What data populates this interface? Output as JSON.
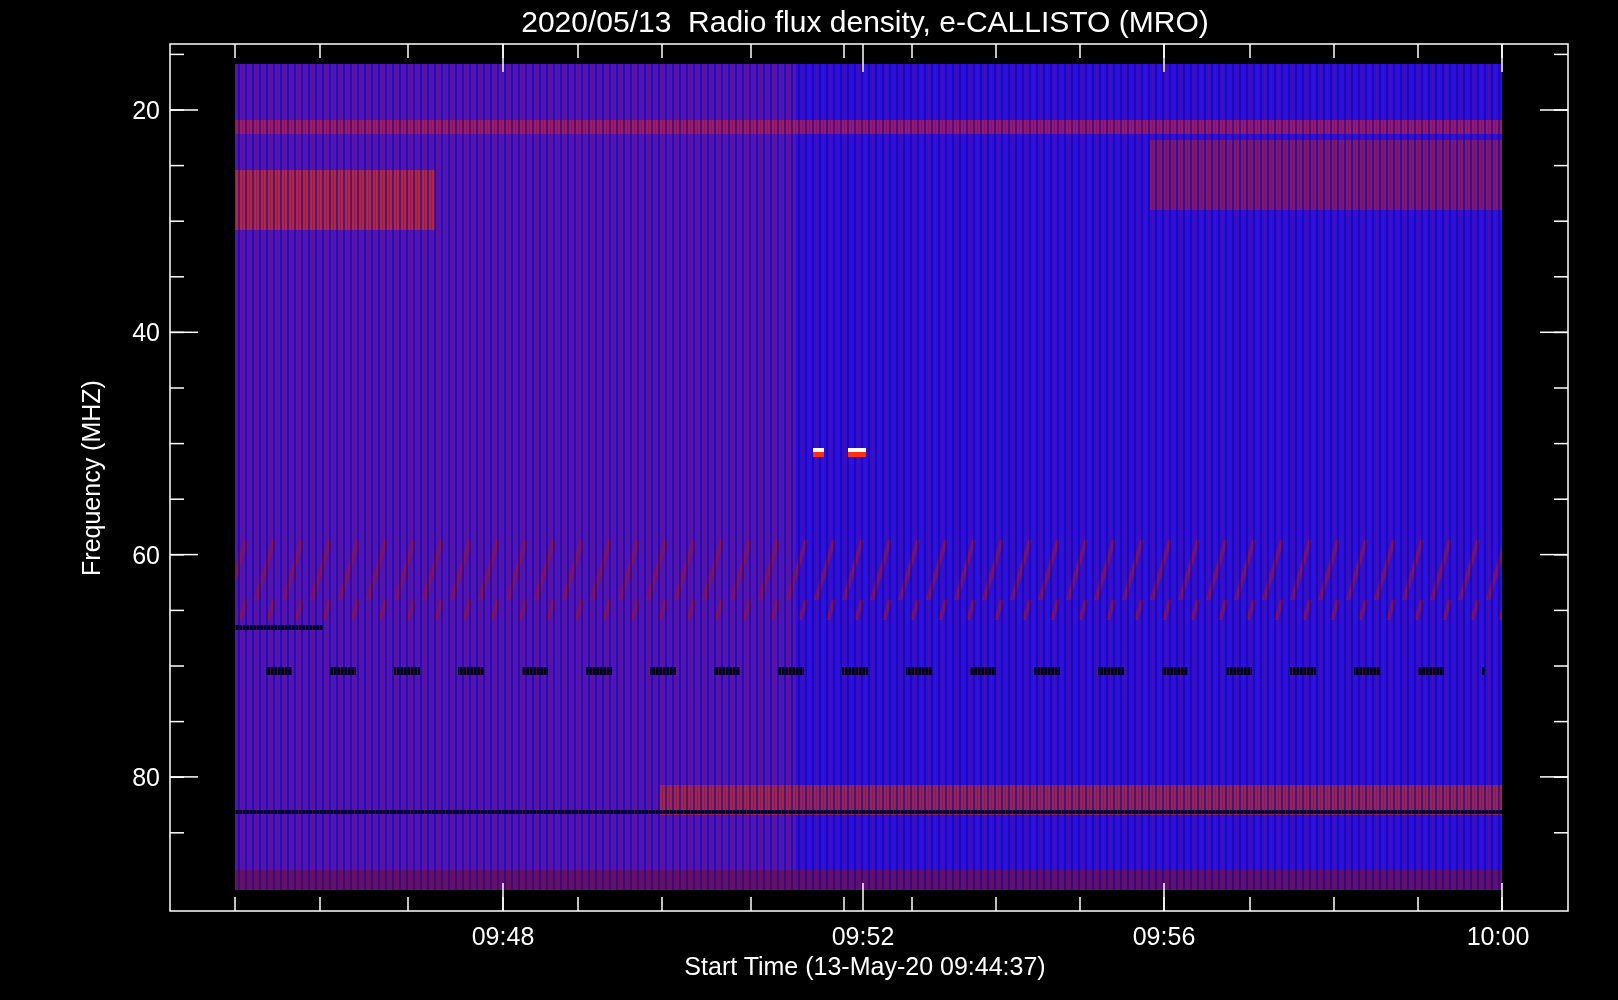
{
  "plot": {
    "title": "2020/05/13  Radio flux density, e-CALLISTO (MRO)",
    "ylabel": "Frequency (MHZ)",
    "xlabel": "Start Time (13-May-20 09:44:37)",
    "yticks": [
      "20",
      "40",
      "60",
      "80"
    ],
    "xticks": [
      "09:48",
      "09:52",
      "09:56",
      "10:00"
    ]
  }
}
